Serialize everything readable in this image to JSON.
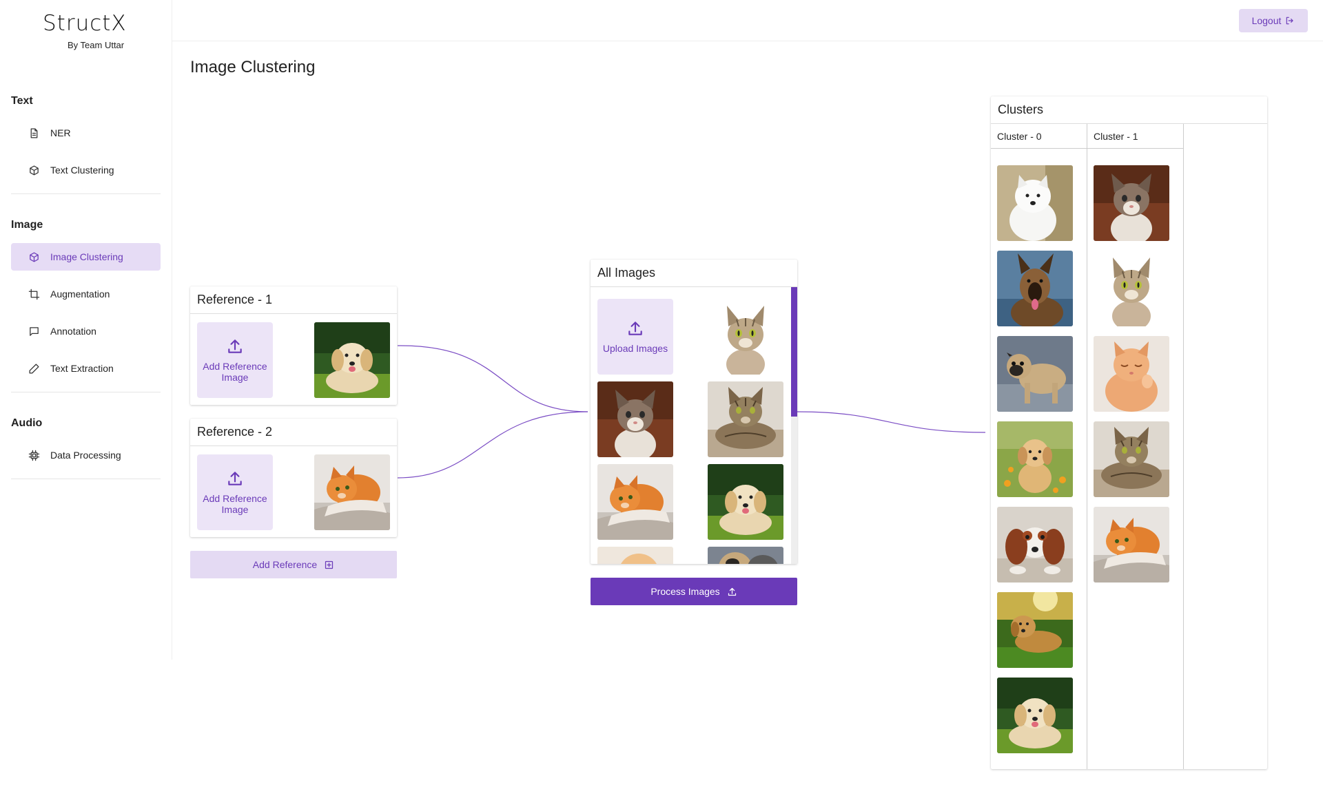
{
  "brand": {
    "name": "StructX",
    "subtitle": "By Team Uttar"
  },
  "sidebar": {
    "sections": [
      {
        "title": "Text",
        "items": [
          {
            "label": "NER",
            "icon": "document-icon"
          },
          {
            "label": "Text Clustering",
            "icon": "cube-icon"
          }
        ]
      },
      {
        "title": "Image",
        "items": [
          {
            "label": "Image Clustering",
            "icon": "cube-icon",
            "active": true
          },
          {
            "label": "Augmentation",
            "icon": "crop-icon"
          },
          {
            "label": "Annotation",
            "icon": "message-square-icon"
          },
          {
            "label": "Text Extraction",
            "icon": "pencil-icon"
          }
        ]
      },
      {
        "title": "Audio",
        "items": [
          {
            "label": "Data Processing",
            "icon": "cpu-icon"
          }
        ]
      }
    ]
  },
  "header": {
    "logout_label": "Logout"
  },
  "page": {
    "title": "Image Clustering"
  },
  "references": [
    {
      "title": "Reference - 1",
      "upload_label": "Add Reference Image",
      "image": "golden-puppy-on-grass"
    },
    {
      "title": "Reference - 2",
      "upload_label": "Add Reference Image",
      "image": "orange-cat-on-blanket"
    }
  ],
  "add_reference_label": "Add Reference",
  "all_images": {
    "title": "All Images",
    "upload_label": "Upload Images",
    "images": [
      "tabby-cat-white-bg",
      "tabby-kitten-brown-bg",
      "tabby-cat-lying",
      "orange-cat-on-blanket",
      "golden-puppy-on-grass",
      "ginger-cat-partial",
      "pug-partial"
    ]
  },
  "process_label": "Process Images",
  "clusters": {
    "title": "Clusters",
    "columns": [
      {
        "label": "Cluster - 0",
        "images": [
          "white-puppy",
          "german-shepherd",
          "pug",
          "golden-puppy-flowers",
          "spaniel-lying",
          "golden-retriever-grass",
          "golden-puppy-on-grass"
        ]
      },
      {
        "label": "Cluster - 1",
        "images": [
          "tabby-kitten-brown-bg",
          "tabby-cat-white-bg",
          "ginger-cat-sleeping",
          "tabby-cat-lying",
          "orange-cat-on-blanket"
        ]
      }
    ]
  },
  "colors": {
    "accent": "#6a3ab8",
    "accent_light": "#e4daf3",
    "connector": "#7a4cc4"
  }
}
